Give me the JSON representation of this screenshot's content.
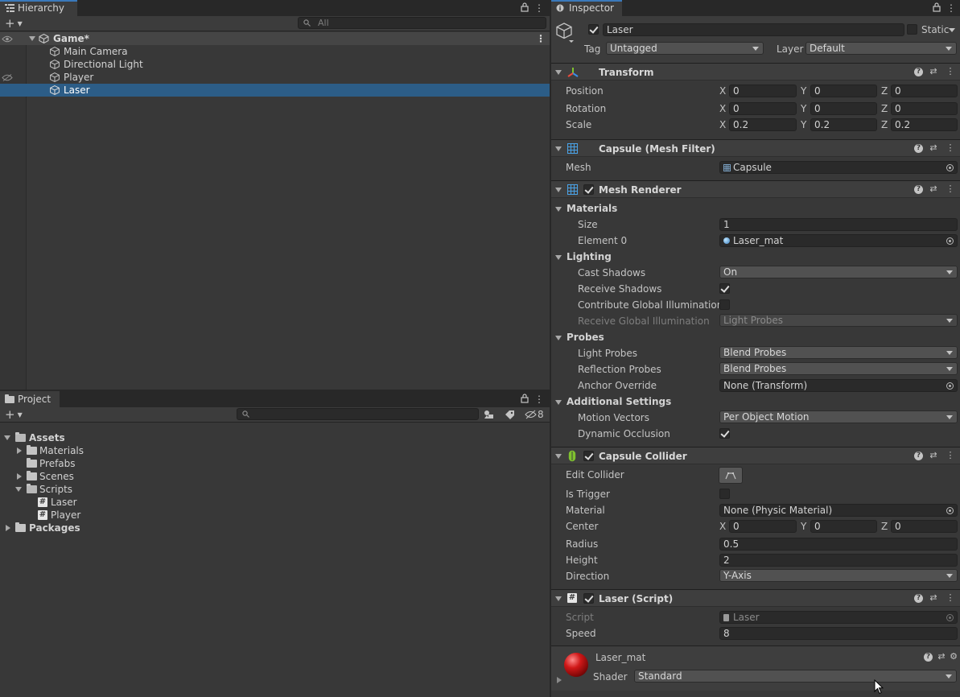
{
  "hierarchy": {
    "tab_label": "Hierarchy",
    "search_placeholder": "All",
    "scene_name": "Game*",
    "items": [
      {
        "label": "Main Camera"
      },
      {
        "label": "Directional Light"
      },
      {
        "label": "Player"
      },
      {
        "label": "Laser"
      }
    ]
  },
  "project": {
    "tab_label": "Project",
    "badge_count": "8",
    "tree": {
      "assets": "Assets",
      "materials": "Materials",
      "prefabs": "Prefabs",
      "scenes": "Scenes",
      "scripts": "Scripts",
      "script_laser": "Laser",
      "script_player": "Player",
      "packages": "Packages"
    }
  },
  "inspector": {
    "tab_label": "Inspector",
    "object_name": "Laser",
    "static_label": "Static",
    "tag_label": "Tag",
    "tag_value": "Untagged",
    "layer_label": "Layer",
    "layer_value": "Default",
    "transform": {
      "title": "Transform",
      "position_label": "Position",
      "rotation_label": "Rotation",
      "scale_label": "Scale",
      "position": {
        "x": "0",
        "y": "0",
        "z": "0"
      },
      "rotation": {
        "x": "0",
        "y": "0",
        "z": "0"
      },
      "scale": {
        "x": "0.2",
        "y": "0.2",
        "z": "0.2"
      },
      "axis_x": "X",
      "axis_y": "Y",
      "axis_z": "Z"
    },
    "mesh_filter": {
      "title": "Capsule (Mesh Filter)",
      "mesh_label": "Mesh",
      "mesh_value": "Capsule"
    },
    "mesh_renderer": {
      "title": "Mesh Renderer",
      "materials_header": "Materials",
      "size_label": "Size",
      "size_value": "1",
      "element0_label": "Element 0",
      "element0_value": "Laser_mat",
      "lighting_header": "Lighting",
      "cast_shadows_label": "Cast Shadows",
      "cast_shadows_value": "On",
      "receive_shadows_label": "Receive Shadows",
      "contribute_gi_label": "Contribute Global Illumination",
      "receive_gi_label": "Receive Global Illumination",
      "receive_gi_value": "Light Probes",
      "probes_header": "Probes",
      "light_probes_label": "Light Probes",
      "light_probes_value": "Blend Probes",
      "reflection_probes_label": "Reflection Probes",
      "reflection_probes_value": "Blend Probes",
      "anchor_override_label": "Anchor Override",
      "anchor_override_value": "None (Transform)",
      "additional_header": "Additional Settings",
      "motion_vectors_label": "Motion Vectors",
      "motion_vectors_value": "Per Object Motion",
      "dynamic_occlusion_label": "Dynamic Occlusion"
    },
    "capsule_collider": {
      "title": "Capsule Collider",
      "edit_collider_label": "Edit Collider",
      "is_trigger_label": "Is Trigger",
      "material_label": "Material",
      "material_value": "None (Physic Material)",
      "center_label": "Center",
      "center": {
        "x": "0",
        "y": "0",
        "z": "0"
      },
      "radius_label": "Radius",
      "radius_value": "0.5",
      "height_label": "Height",
      "height_value": "2",
      "direction_label": "Direction",
      "direction_value": "Y-Axis"
    },
    "laser_script": {
      "title": "Laser (Script)",
      "script_label": "Script",
      "script_value": "Laser",
      "speed_label": "Speed",
      "speed_value": "8"
    },
    "material": {
      "name": "Laser_mat",
      "shader_label": "Shader",
      "shader_value": "Standard"
    }
  },
  "colors": {
    "selection": "#2c5d87",
    "accent": "#3a79bb",
    "panel": "#383838"
  }
}
